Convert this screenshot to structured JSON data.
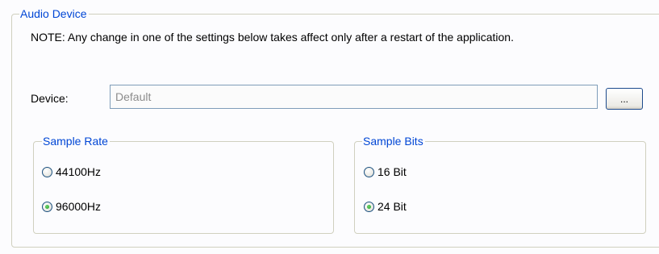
{
  "audio_device": {
    "title": "Audio Device",
    "note": "NOTE: Any change in one of the settings below takes affect only after a restart of the application.",
    "device_label": "Device:",
    "device_value": "Default",
    "browse_label": "..."
  },
  "sample_rate": {
    "title": "Sample Rate",
    "options": [
      {
        "label": "44100Hz",
        "selected": false
      },
      {
        "label": "96000Hz",
        "selected": true
      }
    ]
  },
  "sample_bits": {
    "title": "Sample Bits",
    "options": [
      {
        "label": "16 Bit",
        "selected": false
      },
      {
        "label": "24 Bit",
        "selected": true
      }
    ]
  },
  "colors": {
    "group_title": "#0046d5",
    "group_border": "#d0d0bf",
    "radio_selected": "#21a121"
  }
}
